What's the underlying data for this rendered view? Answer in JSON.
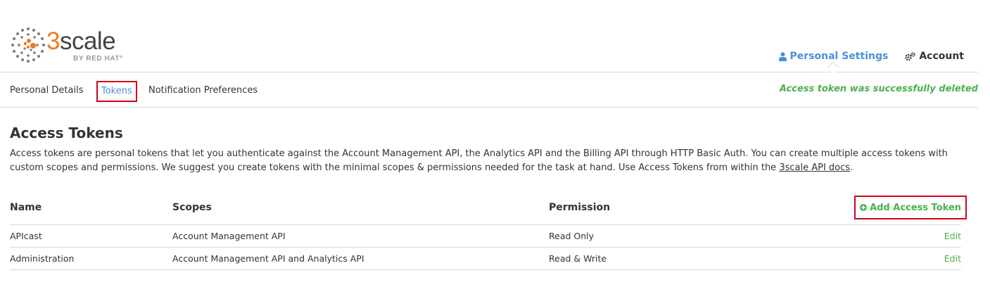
{
  "brand": {
    "name_prefix": "3",
    "name_suffix": "scale",
    "byline": "BY RED HAT",
    "trademark": "°",
    "accent": "#ee7a1f"
  },
  "top_nav": [
    {
      "label": "Personal Settings",
      "icon": "user-icon",
      "active": true
    },
    {
      "label": "Account",
      "icon": "gears-icon",
      "active": false
    }
  ],
  "sub_tabs": [
    {
      "label": "Personal Details"
    },
    {
      "label": "Tokens",
      "active": true
    },
    {
      "label": "Notification Preferences"
    }
  ],
  "flash": "Access token was successfully deleted",
  "page": {
    "title": "Access Tokens",
    "intro_text": "Access tokens are personal tokens that let you authenticate against the Account Management API, the Analytics API and the Billing API through HTTP Basic Auth. You can create multiple access tokens with custom scopes and permissions. We suggest you create tokens with the minimal scopes & permissions needed for the task at hand. Use Access Tokens from within the ",
    "intro_link": "3scale API docs",
    "intro_end": "."
  },
  "table": {
    "headers": [
      "Name",
      "Scopes",
      "Permission"
    ],
    "add_button": "Add Access Token",
    "rows": [
      {
        "name": "APIcast",
        "scopes": "Account Management API",
        "permission": "Read Only",
        "action": "Edit"
      },
      {
        "name": "Administration",
        "scopes": "Account Management API and Analytics API",
        "permission": "Read & Write",
        "action": "Edit"
      }
    ]
  },
  "colors": {
    "link_blue": "#4a90d9",
    "success_green": "#4caf50",
    "highlight_red": "#d0021b"
  }
}
